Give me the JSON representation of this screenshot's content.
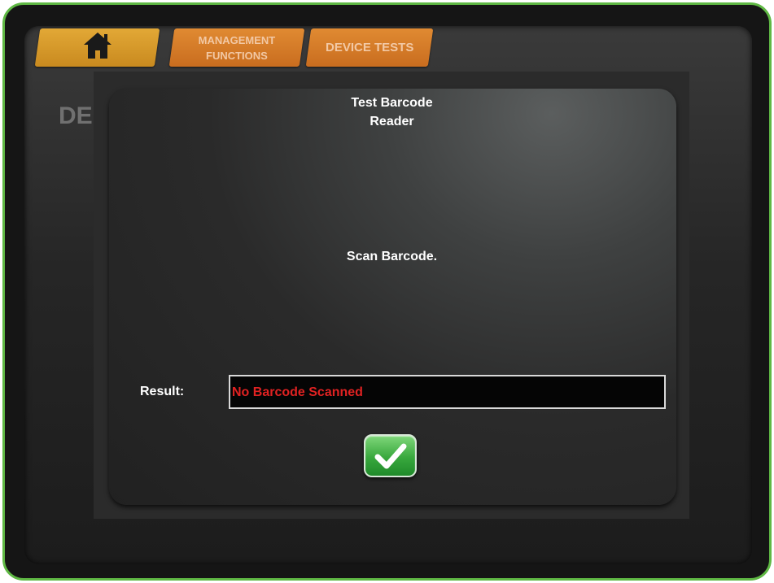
{
  "nav": {
    "tabs": [
      {
        "icon": "home-icon",
        "label": ""
      },
      {
        "label_line1": "MANAGEMENT",
        "label_line2": "FUNCTIONS"
      },
      {
        "label": "DEVICE TESTS"
      }
    ]
  },
  "background": {
    "heading": "DE"
  },
  "dialog": {
    "title_line1": "Test Barcode",
    "title_line2": "Reader",
    "instruction": "Scan Barcode.",
    "result_label": "Result:",
    "result_value": "No Barcode Scanned",
    "ok_icon": "checkmark-icon"
  },
  "colors": {
    "frame_border": "#5fb844",
    "tab_orange": "#e08a32",
    "result_text": "#e02222",
    "ok_green": "#38a83d"
  }
}
